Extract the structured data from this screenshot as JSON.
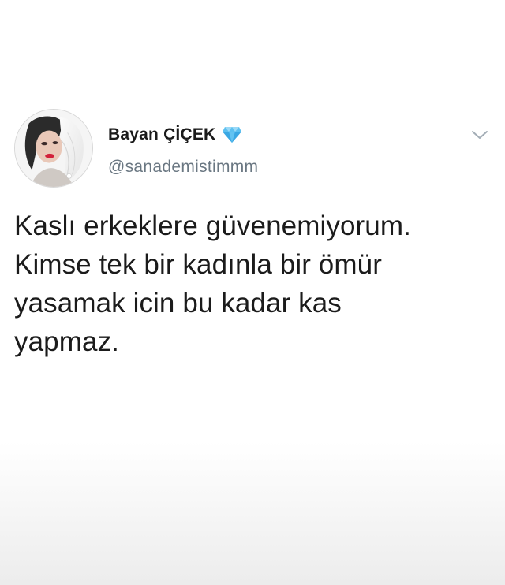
{
  "tweet": {
    "author": {
      "display_name": "Bayan ÇİÇEK",
      "handle": "@sanademistimmm",
      "badge_icon": "diamond-icon",
      "badge_color": "#4fb6ec"
    },
    "menu_icon": "chevron-down-icon",
    "text_lines": [
      "Kaslı erkeklere güvenemiyorum.",
      "Kimse tek bir kadınla bir ömür",
      "yasamak icin bu kadar kas",
      "yapmaz."
    ]
  },
  "colors": {
    "text": "#1b1b1b",
    "handle": "#6a7782",
    "background": "#ffffff"
  }
}
